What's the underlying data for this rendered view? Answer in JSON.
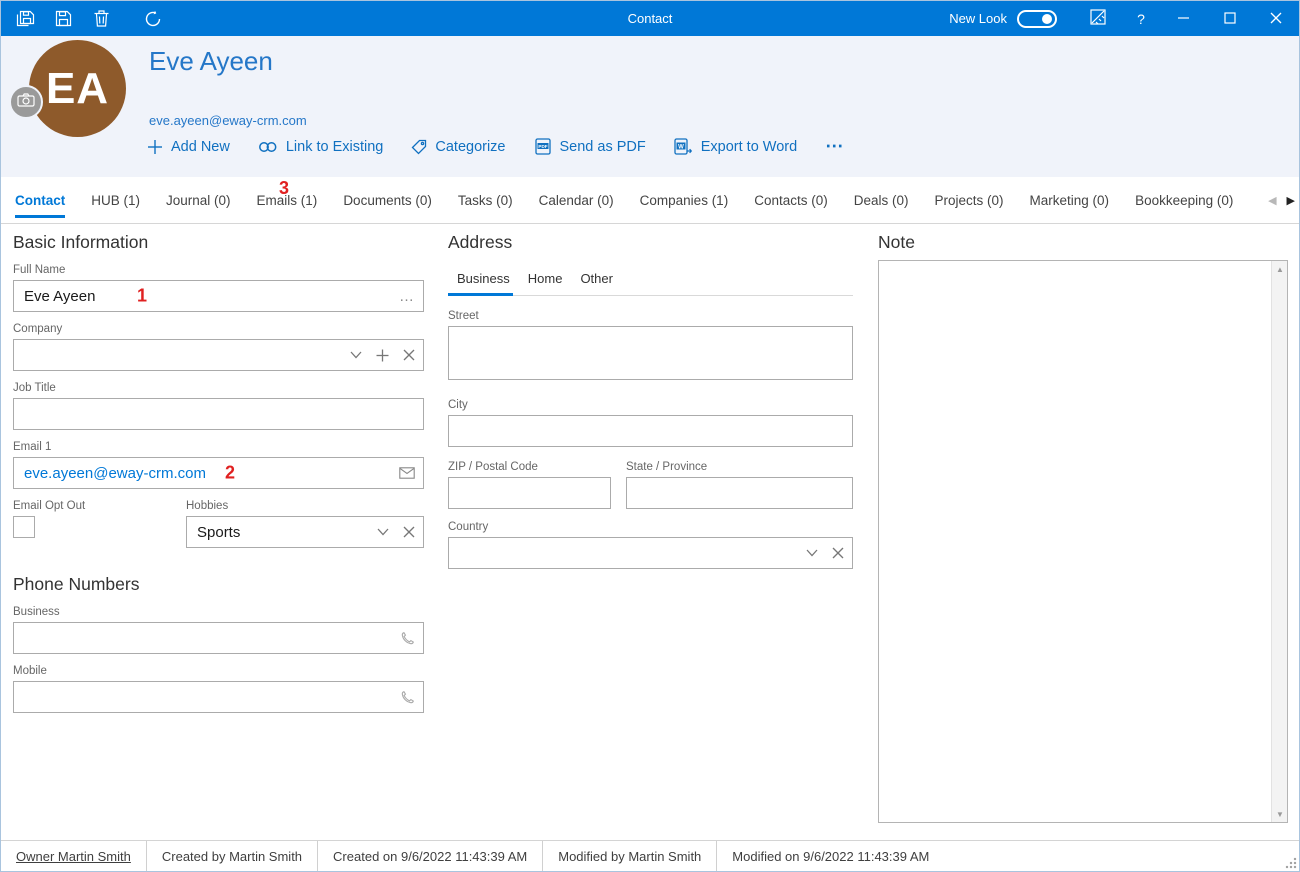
{
  "colors": {
    "titlebar_blue": "#0078D7",
    "accent_blue": "#0078D7",
    "link_blue": "#1070C0",
    "name_blue": "#2577C8",
    "avatar_brown": "#8E5A2B",
    "annotation_red": "#E02020",
    "header_bg": "#F0F3FA"
  },
  "titlebar": {
    "title": "Contact",
    "new_look_label": "New Look",
    "new_look_on": true,
    "help_label": "?"
  },
  "header": {
    "avatar_initials": "EA",
    "name": "Eve Ayeen",
    "email": "eve.ayeen@eway-crm.com",
    "actions": [
      {
        "label": "Add New"
      },
      {
        "label": "Link to Existing"
      },
      {
        "label": "Categorize"
      },
      {
        "label": "Send as PDF"
      },
      {
        "label": "Export to Word"
      }
    ],
    "more_label": "⋯"
  },
  "tabs": [
    {
      "label": "Contact",
      "active": true
    },
    {
      "label": "HUB (1)",
      "active": false
    },
    {
      "label": "Journal (0)",
      "active": false
    },
    {
      "label": "Emails (1)",
      "active": false
    },
    {
      "label": "Documents (0)",
      "active": false
    },
    {
      "label": "Tasks (0)",
      "active": false
    },
    {
      "label": "Calendar (0)",
      "active": false
    },
    {
      "label": "Companies (1)",
      "active": false
    },
    {
      "label": "Contacts (0)",
      "active": false
    },
    {
      "label": "Deals (0)",
      "active": false
    },
    {
      "label": "Projects (0)",
      "active": false
    },
    {
      "label": "Marketing (0)",
      "active": false
    },
    {
      "label": "Bookkeeping (0)",
      "active": false
    }
  ],
  "annotations": {
    "one": "1",
    "two": "2",
    "three": "3"
  },
  "form": {
    "basic_information": {
      "heading": "Basic Information",
      "full_name": {
        "label": "Full Name",
        "value": "Eve Ayeen",
        "more_label": "…"
      },
      "company": {
        "label": "Company",
        "value": ""
      },
      "job_title": {
        "label": "Job Title",
        "value": ""
      },
      "email1": {
        "label": "Email 1",
        "value": "eve.ayeen@eway-crm.com"
      },
      "email_opt_out": {
        "label": "Email Opt Out",
        "checked": false
      },
      "hobbies": {
        "label": "Hobbies",
        "value": "Sports"
      }
    },
    "phone_numbers": {
      "heading": "Phone Numbers",
      "business": {
        "label": "Business",
        "value": ""
      },
      "mobile": {
        "label": "Mobile",
        "value": ""
      }
    },
    "address": {
      "heading": "Address",
      "tabs": [
        {
          "label": "Business",
          "active": true
        },
        {
          "label": "Home",
          "active": false
        },
        {
          "label": "Other",
          "active": false
        }
      ],
      "street": {
        "label": "Street",
        "value": ""
      },
      "city": {
        "label": "City",
        "value": ""
      },
      "zip": {
        "label": "ZIP / Postal Code",
        "value": ""
      },
      "state": {
        "label": "State / Province",
        "value": ""
      },
      "country": {
        "label": "Country",
        "value": ""
      }
    },
    "note": {
      "heading": "Note",
      "value": ""
    }
  },
  "footer": {
    "items": [
      "Owner Martin Smith",
      "Created by Martin Smith",
      "Created on 9/6/2022 11:43:39 AM",
      "Modified by Martin Smith",
      "Modified on 9/6/2022 11:43:39 AM"
    ]
  }
}
